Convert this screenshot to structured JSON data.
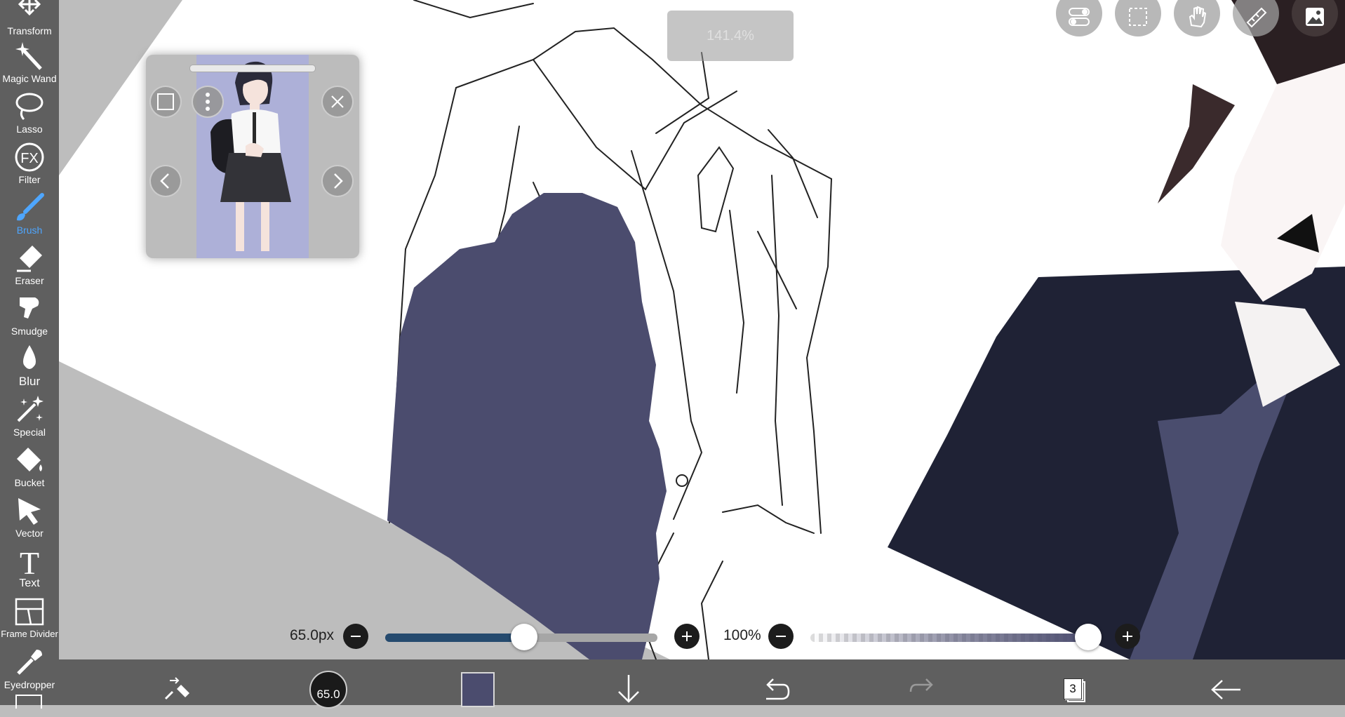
{
  "toolbar": {
    "tools": [
      {
        "label": "Transform",
        "icon": "move-arrows-icon"
      },
      {
        "label": "Magic Wand",
        "icon": "magic-wand-icon"
      },
      {
        "label": "Lasso",
        "icon": "lasso-icon"
      },
      {
        "label": "Filter",
        "icon": "fx-icon",
        "icon_text": "FX"
      },
      {
        "label": "Brush",
        "icon": "brush-icon",
        "active": true
      },
      {
        "label": "Eraser",
        "icon": "eraser-icon"
      },
      {
        "label": "Smudge",
        "icon": "smudge-icon"
      },
      {
        "label": "Blur",
        "icon": "blur-drop-icon"
      },
      {
        "label": "Special",
        "icon": "special-sparkle-icon"
      },
      {
        "label": "Bucket",
        "icon": "bucket-icon"
      },
      {
        "label": "Vector",
        "icon": "vector-cursor-icon"
      },
      {
        "label": "Text",
        "icon": "text-icon",
        "icon_text": "T"
      },
      {
        "label": "Frame Divider",
        "icon": "frame-divider-icon"
      },
      {
        "label": "Eyedropper",
        "icon": "eyedropper-icon"
      }
    ],
    "active_color": "#4ea6ff"
  },
  "canvas": {
    "zoom_text": "141.4%"
  },
  "top_buttons": [
    {
      "name": "toggle-settings-icon"
    },
    {
      "name": "selection-icon"
    },
    {
      "name": "hand-pan-icon"
    },
    {
      "name": "ruler-icon"
    },
    {
      "name": "image-material-icon"
    }
  ],
  "reference_window": {
    "buttons": [
      "frame-icon",
      "more-vertical-icon",
      "close-icon",
      "chevron-left-icon",
      "chevron-right-icon"
    ]
  },
  "brush_size": {
    "text": "65.0px",
    "fraction": 0.51
  },
  "opacity": {
    "text": "100%",
    "fraction": 1.0
  },
  "bottom_bar": {
    "brush_size_label": "65.0",
    "current_color": "#4b4c6e",
    "layer_count": "3",
    "icons": [
      "swap-tool-icon",
      "brush-size-icon",
      "color-swatch",
      "download-arrow-icon",
      "undo-icon",
      "redo-icon",
      "layers-icon",
      "back-arrow-icon"
    ]
  }
}
